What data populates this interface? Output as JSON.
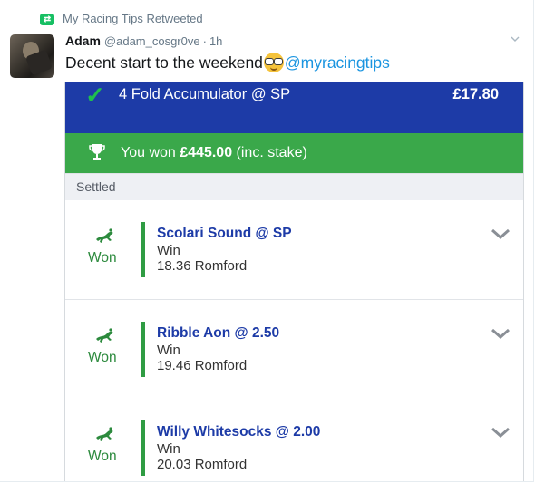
{
  "retweet": {
    "icon": "retweet-icon",
    "label": "My Racing Tips Retweeted"
  },
  "tweet": {
    "name": "Adam",
    "handle": "@adam_cosgr0ve",
    "separator": "·",
    "time": "1h",
    "text": "Decent start to the weekend",
    "emoji": "nerd-face-emoji",
    "mention": "@myracingtips"
  },
  "bet": {
    "type_label": "4 Fold Accumulator @ SP",
    "stake": "£17.80",
    "won_prefix": "You won",
    "won_amount": "£445.00",
    "won_suffix": "(inc. stake)",
    "section_label": "Settled",
    "selections": [
      {
        "title": "Scolari Sound @ SP",
        "market": "Win",
        "race": "18.36 Romford",
        "result": "Won"
      },
      {
        "title": "Ribble Aon @ 2.50",
        "market": "Win",
        "race": "19.46 Romford",
        "result": "Won"
      },
      {
        "title": "Willy Whitesocks @ 2.00",
        "market": "Win",
        "race": "20.03 Romford",
        "result": "Won"
      }
    ]
  },
  "colors": {
    "accumulator_bar": "#1d3ba7",
    "won_bar": "#3aa84a",
    "mention": "#1b95e0",
    "retweet_icon": "#17bf63"
  }
}
